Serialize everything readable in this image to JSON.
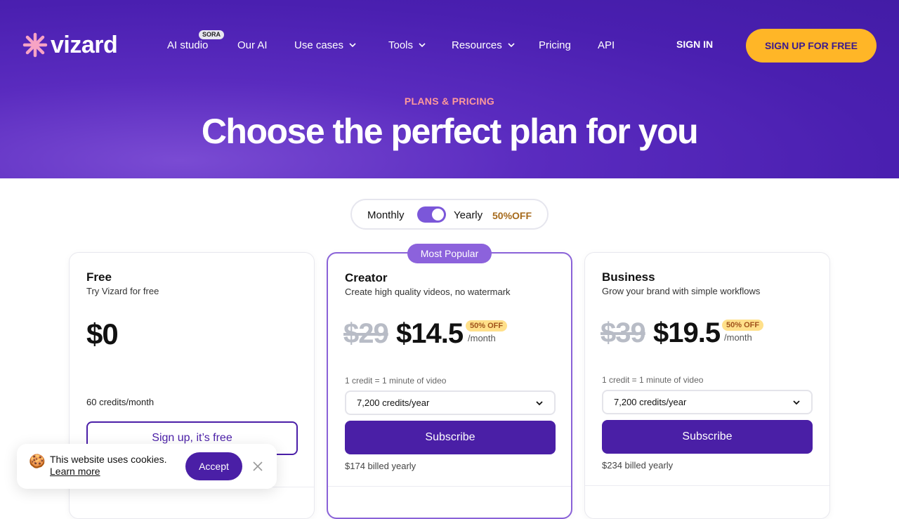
{
  "header": {
    "logo_text": "vizard",
    "nav": [
      {
        "label": "AI studio",
        "badge": "SORA"
      },
      {
        "label": "Our AI"
      },
      {
        "label": "Use cases",
        "dropdown": true
      },
      {
        "label": "Tools",
        "dropdown": true
      },
      {
        "label": "Resources",
        "dropdown": true
      },
      {
        "label": "Pricing"
      },
      {
        "label": "API"
      }
    ],
    "sign_in": "SIGN IN",
    "sign_up": "SIGN UP FOR FREE"
  },
  "hero": {
    "eyebrow": "PLANS & PRICING",
    "title": "Choose the perfect plan for you"
  },
  "billing_toggle": {
    "monthly": "Monthly",
    "yearly": "Yearly",
    "discount": "50%OFF",
    "selected": "Yearly"
  },
  "plans": [
    {
      "name": "Free",
      "description": "Try Vizard for free",
      "price": "$0",
      "credits": "60 credits/month",
      "cta": "Sign up, it’s free"
    },
    {
      "name": "Creator",
      "description": "Create high quality videos, no watermark",
      "old_price": "$29",
      "price": "$14.5",
      "discount": "50% OFF",
      "period": "/month",
      "credit_note": "1 credit = 1 minute of video",
      "credits_select": "7,200 credits/year",
      "cta": "Subscribe",
      "billed": "$174 billed yearly",
      "badge": "Most Popular"
    },
    {
      "name": "Business",
      "description": "Grow your brand with simple workflows",
      "old_price": "$39",
      "price": "$19.5",
      "discount": "50% OFF",
      "period": "/month",
      "credit_note": "1 credit = 1 minute of video",
      "credits_select": "7,200 credits/year",
      "cta": "Subscribe",
      "billed": "$234 billed yearly"
    }
  ],
  "cookie_banner": {
    "emoji": "🍪",
    "text": "This website uses cookies.",
    "link": "Learn more",
    "accept": "Accept"
  },
  "colors": {
    "brand_purple": "#4a1fa6",
    "accent_yellow": "#ffb627",
    "popular_purple": "#8c62dc"
  }
}
